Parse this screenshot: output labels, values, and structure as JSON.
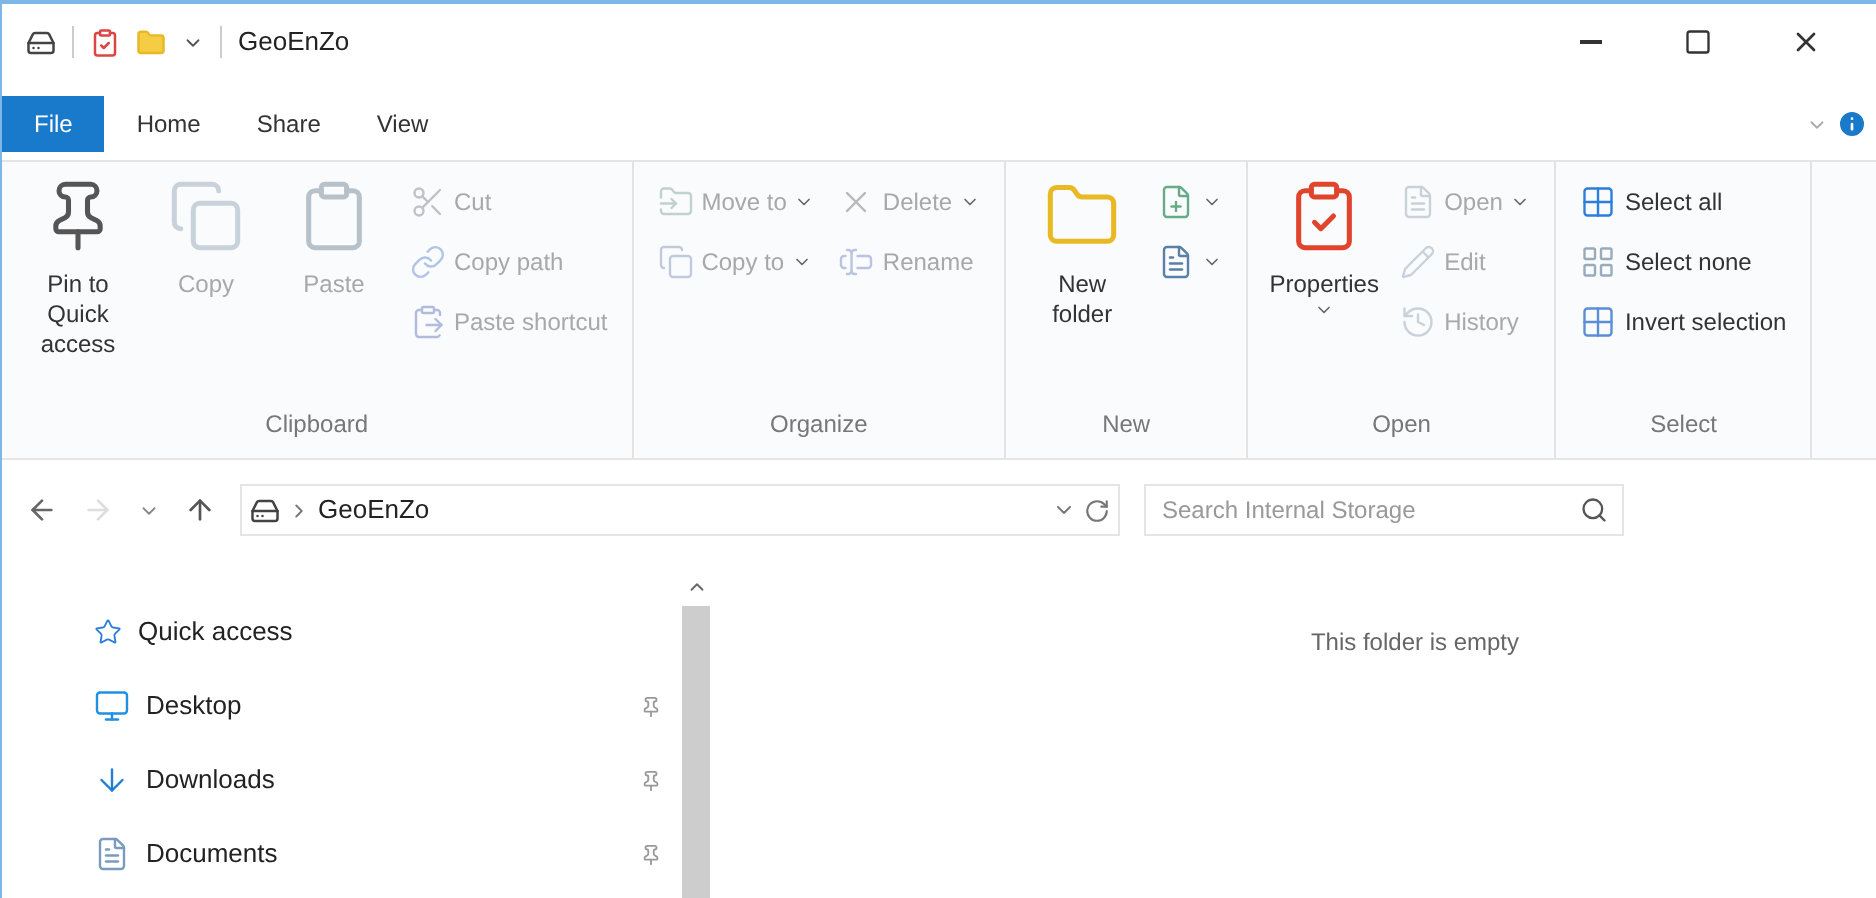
{
  "window": {
    "title": "GeoEnZo"
  },
  "tabs": [
    {
      "label": "File",
      "kind": "file"
    },
    {
      "label": "Home",
      "kind": "tab"
    },
    {
      "label": "Share",
      "kind": "tab"
    },
    {
      "label": "View",
      "kind": "tab"
    }
  ],
  "ribbon": [
    {
      "label": "Clipboard",
      "items": [
        {
          "kind": "large",
          "label": "Pin to Quick access",
          "disabled": false
        },
        {
          "kind": "large",
          "label": "Copy",
          "disabled": true
        },
        {
          "kind": "large",
          "label": "Paste",
          "disabled": true
        },
        {
          "kind": "stack",
          "children": [
            {
              "label": "Cut",
              "disabled": true,
              "dropdown": false
            },
            {
              "label": "Copy path",
              "disabled": true,
              "dropdown": false
            },
            {
              "label": "Paste shortcut",
              "disabled": true,
              "dropdown": false
            }
          ]
        }
      ]
    },
    {
      "label": "Organize",
      "items": [
        {
          "kind": "stack",
          "children": [
            {
              "label": "Move to",
              "disabled": true,
              "dropdown": true
            },
            {
              "label": "Copy to",
              "disabled": true,
              "dropdown": true
            }
          ]
        },
        {
          "kind": "stack",
          "children": [
            {
              "label": "Delete",
              "disabled": true,
              "dropdown": true
            },
            {
              "label": "Rename",
              "disabled": true,
              "dropdown": false
            }
          ]
        }
      ]
    },
    {
      "label": "New",
      "items": [
        {
          "kind": "large",
          "label": "New folder",
          "disabled": false
        },
        {
          "kind": "stack",
          "children": [
            {
              "disabled": false,
              "dropdown": true
            },
            {
              "disabled": false,
              "dropdown": true
            }
          ]
        }
      ]
    },
    {
      "label": "Open",
      "items": [
        {
          "kind": "large",
          "label": "Properties",
          "disabled": false,
          "dropdown": true
        },
        {
          "kind": "stack",
          "children": [
            {
              "label": "Open",
              "disabled": true,
              "dropdown": true
            },
            {
              "label": "Edit",
              "disabled": true,
              "dropdown": false
            },
            {
              "label": "History",
              "disabled": true,
              "dropdown": false
            }
          ]
        }
      ]
    },
    {
      "label": "Select",
      "items": [
        {
          "kind": "stack",
          "children": [
            {
              "label": "Select all",
              "disabled": false,
              "dropdown": false
            },
            {
              "label": "Select none",
              "disabled": false,
              "dropdown": false
            },
            {
              "label": "Invert selection",
              "disabled": false,
              "dropdown": false
            }
          ]
        }
      ]
    }
  ],
  "address": {
    "path": "GeoEnZo"
  },
  "search": {
    "placeholder": "Search Internal Storage"
  },
  "sidebar": {
    "items": [
      {
        "label": "Quick access",
        "pinned": false
      },
      {
        "label": "Desktop",
        "pinned": true
      },
      {
        "label": "Downloads",
        "pinned": true
      },
      {
        "label": "Documents",
        "pinned": true
      }
    ]
  },
  "content": {
    "message": "This folder is empty"
  }
}
